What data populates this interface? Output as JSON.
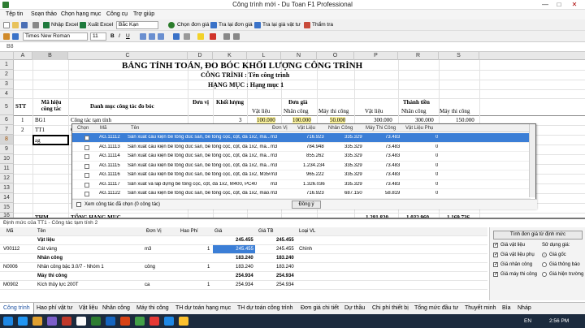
{
  "window": {
    "title": "Công trình mới - Du Toan F1 Professional",
    "min": "—",
    "max": "□",
    "close": "✕"
  },
  "menu": [
    "Tệp tin",
    "Soạn thảo",
    "Chọn hạng mục",
    "Công cụ",
    "Trợ giúp"
  ],
  "toolbar": {
    "import_excel": "Nhập Excel",
    "export_excel": "Xuất Excel",
    "region": "Bắc Kạn",
    "pick_price": "Chọn đơn giá",
    "lookup_price": "Tra lại đơn giá",
    "lookup_material": "Tra lại giá vật tư",
    "review": "Thẩm tra"
  },
  "format": {
    "font": "Times New Roman",
    "size": "11"
  },
  "formula_bar": {
    "cell": "B8"
  },
  "columns": [
    "A",
    "B",
    "C",
    "D",
    "K",
    "L",
    "N",
    "O",
    "P",
    "R",
    "S"
  ],
  "rows": [
    "1",
    "2",
    "3",
    "4",
    "5",
    "6",
    "7",
    "8",
    "9",
    "10",
    "11",
    "12",
    "13",
    "14",
    "15",
    "16"
  ],
  "sheet": {
    "title": "BẢNG TÍNH TOÁN, ĐO BÓC KHỐI LƯỢNG CÔNG TRÌNH",
    "project": "CÔNG TRÌNH : Tên công trình",
    "item": "HẠNG MỤC : Hạng mục 1",
    "headers": {
      "stt": "STT",
      "code": "Mã hiệu công tác",
      "name": "Danh mục công tác đo bóc",
      "unit": "Đơn vị",
      "qty": "Khối lượng",
      "unit_price": "Đơn giá",
      "amount": "Thành tiền",
      "vl": "Vật liệu",
      "nc": "Nhân công",
      "mtc": "Máy thi công"
    },
    "r6": {
      "stt": "1",
      "code": "BG1",
      "name": "Công tác tạm tính",
      "qty": "3",
      "vl": "100.000",
      "nc": "100.000",
      "mtc": "50.000",
      "tvl": "300.000",
      "tnc": "300.000",
      "tmtc": "150.000"
    },
    "r7": {
      "stt": "2",
      "code": "TT1",
      "name": "C"
    },
    "r8": {
      "code": "ag"
    },
    "r15": {
      "code": "THM",
      "name": "TỔNG HẠNG MỤC",
      "tvl": "1.281.820",
      "tnc": "1.032.960",
      "tmtc": "1.169.736"
    }
  },
  "popup": {
    "headers": [
      "Chọn",
      "Mã",
      "Tên",
      "Đơn Vị",
      "Vật Liệu",
      "Nhân Công",
      "Máy Thi Công",
      "Vật Liệu Phụ"
    ],
    "rows": [
      {
        "code": "AG.11112",
        "name": "Sản xuất cấu kiện bê tông đúc sẵn, bê tông cọc, cột, đá 1x2, má...",
        "unit": "m3",
        "vl": "716.923",
        "nc": "335.329",
        "mtc": "73.483",
        "vlp": "0"
      },
      {
        "code": "AG.11113",
        "name": "Sản xuất cấu kiện bê tông đúc sẵn, bê tông cọc, cột, đá 1x2, má...",
        "unit": "m3",
        "vl": "784.948",
        "nc": "335.329",
        "mtc": "73.483",
        "vlp": "0"
      },
      {
        "code": "AG.11114",
        "name": "Sản xuất cấu kiện bê tông đúc sẵn, bê tông cọc, cột, đá 1x2, má...",
        "unit": "m3",
        "vl": "855.262",
        "nc": "335.329",
        "mtc": "73.483",
        "vlp": "0"
      },
      {
        "code": "AG.11115",
        "name": "Sản xuất cấu kiện bê tông đúc sẵn, bê tông cọc, cột, đá 1x2, má...",
        "unit": "m3",
        "vl": "1.234.234",
        "nc": "335.329",
        "mtc": "73.483",
        "vlp": "0"
      },
      {
        "code": "AG.11116",
        "name": "Sản xuất cấu kiện bê tông đúc sẵn, bê tông cọc, cột, đá 1x2, M350, PC40",
        "unit": "m3",
        "vl": "965.222",
        "nc": "335.329",
        "mtc": "73.483",
        "vlp": "0"
      },
      {
        "code": "AG.11117",
        "name": "Sản xuất và lắp dựng bê tông cọc, cột, đá 1x2, M400, PC40",
        "unit": "m3",
        "vl": "1.326.036",
        "nc": "335.329",
        "mtc": "73.483",
        "vlp": "0"
      },
      {
        "code": "AG.11122",
        "name": "Sản xuất cấu kiện bê tông đúc sẵn, bê tông cọc, cột, đá 1x2, máo...",
        "unit": "m3",
        "vl": "716.923",
        "nc": "687.150",
        "mtc": "58.819",
        "vlp": "0"
      }
    ],
    "show_selected": "Xem công tác đã chọn (0 công tác)",
    "ok": "Đồng ý"
  },
  "detail": {
    "title": "Định mức của TT1 - Công tác tạm tính 2",
    "headers": [
      "Mã",
      "Tên",
      "Đơn Vị",
      "Hao Phí",
      "Giá",
      "Giá TB",
      "Loại VL"
    ],
    "rows": [
      {
        "code": "",
        "name": "Vật liệu",
        "unit": "",
        "hp": "",
        "gia": "245.455",
        "tb": "245.455",
        "loai": "",
        "bold": true
      },
      {
        "code": "V00112",
        "name": "Cát vàng",
        "unit": "m3",
        "hp": "1",
        "gia": "245.455",
        "tb": "245.455",
        "loai": "Chính",
        "bold": false
      },
      {
        "code": "",
        "name": "Nhân công",
        "unit": "",
        "hp": "",
        "gia": "183.240",
        "tb": "183.240",
        "loai": "",
        "bold": true
      },
      {
        "code": "N0006",
        "name": "Nhân công bậc 3.0/7 - Nhóm 1",
        "unit": "công",
        "hp": "1",
        "gia": "183.240",
        "tb": "183.240",
        "loai": "",
        "bold": false
      },
      {
        "code": "",
        "name": "Máy thi công",
        "unit": "",
        "hp": "",
        "gia": "254.934",
        "tb": "254.934",
        "loai": "",
        "bold": true
      },
      {
        "code": "M0902",
        "name": "Kích thủy lực 200T",
        "unit": "ca",
        "hp": "1",
        "gia": "254.934",
        "tb": "254.934",
        "loai": "",
        "bold": false
      }
    ]
  },
  "right": {
    "btn": "Tính đơn giá từ định mức",
    "checks": [
      "Giá vật liệu",
      "Giá vật liệu phụ",
      "Giá nhân công",
      "Giá máy thi công"
    ],
    "use": "Sử dụng giá:",
    "radios": [
      "Giá gốc",
      "Giá thông báo",
      "Giá hiện trường"
    ]
  },
  "tabs": [
    "Công trình",
    "Hao phí vật tư",
    "Vật liệu",
    "Nhân công",
    "Máy thi công",
    "TH dự toán hạng mục",
    "TH dự toán công trình",
    "Đơn giá chi tiết",
    "Dự thầu",
    "Chi phí thiết bị",
    "Tổng mức đầu tư",
    "Thuyết minh",
    "Bìa",
    "Nháp"
  ],
  "taskbar": {
    "lang": "EN",
    "time": "2:56 PM"
  }
}
